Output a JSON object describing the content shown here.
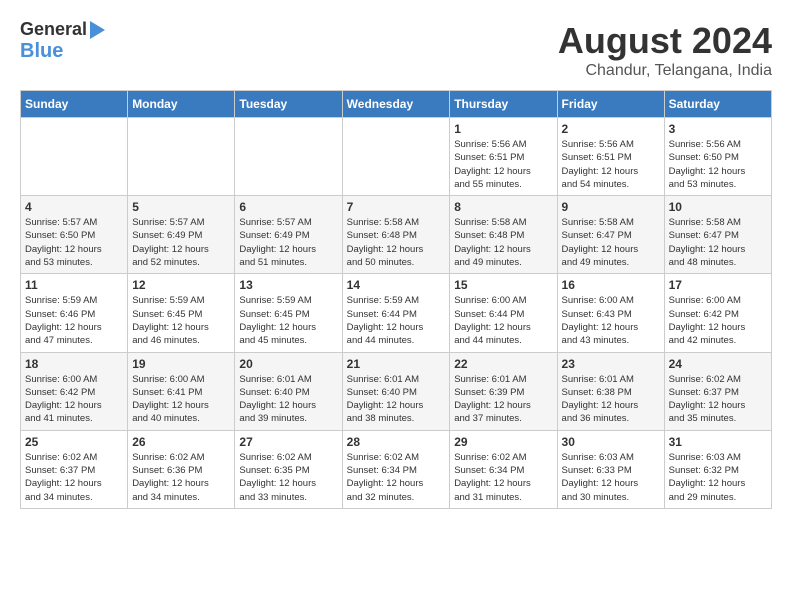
{
  "header": {
    "logo_line1": "General",
    "logo_line2": "Blue",
    "title": "August 2024",
    "subtitle": "Chandur, Telangana, India"
  },
  "calendar": {
    "days_of_week": [
      "Sunday",
      "Monday",
      "Tuesday",
      "Wednesday",
      "Thursday",
      "Friday",
      "Saturday"
    ],
    "weeks": [
      [
        {
          "day": "",
          "info": ""
        },
        {
          "day": "",
          "info": ""
        },
        {
          "day": "",
          "info": ""
        },
        {
          "day": "",
          "info": ""
        },
        {
          "day": "1",
          "info": "Sunrise: 5:56 AM\nSunset: 6:51 PM\nDaylight: 12 hours\nand 55 minutes."
        },
        {
          "day": "2",
          "info": "Sunrise: 5:56 AM\nSunset: 6:51 PM\nDaylight: 12 hours\nand 54 minutes."
        },
        {
          "day": "3",
          "info": "Sunrise: 5:56 AM\nSunset: 6:50 PM\nDaylight: 12 hours\nand 53 minutes."
        }
      ],
      [
        {
          "day": "4",
          "info": "Sunrise: 5:57 AM\nSunset: 6:50 PM\nDaylight: 12 hours\nand 53 minutes."
        },
        {
          "day": "5",
          "info": "Sunrise: 5:57 AM\nSunset: 6:49 PM\nDaylight: 12 hours\nand 52 minutes."
        },
        {
          "day": "6",
          "info": "Sunrise: 5:57 AM\nSunset: 6:49 PM\nDaylight: 12 hours\nand 51 minutes."
        },
        {
          "day": "7",
          "info": "Sunrise: 5:58 AM\nSunset: 6:48 PM\nDaylight: 12 hours\nand 50 minutes."
        },
        {
          "day": "8",
          "info": "Sunrise: 5:58 AM\nSunset: 6:48 PM\nDaylight: 12 hours\nand 49 minutes."
        },
        {
          "day": "9",
          "info": "Sunrise: 5:58 AM\nSunset: 6:47 PM\nDaylight: 12 hours\nand 49 minutes."
        },
        {
          "day": "10",
          "info": "Sunrise: 5:58 AM\nSunset: 6:47 PM\nDaylight: 12 hours\nand 48 minutes."
        }
      ],
      [
        {
          "day": "11",
          "info": "Sunrise: 5:59 AM\nSunset: 6:46 PM\nDaylight: 12 hours\nand 47 minutes."
        },
        {
          "day": "12",
          "info": "Sunrise: 5:59 AM\nSunset: 6:45 PM\nDaylight: 12 hours\nand 46 minutes."
        },
        {
          "day": "13",
          "info": "Sunrise: 5:59 AM\nSunset: 6:45 PM\nDaylight: 12 hours\nand 45 minutes."
        },
        {
          "day": "14",
          "info": "Sunrise: 5:59 AM\nSunset: 6:44 PM\nDaylight: 12 hours\nand 44 minutes."
        },
        {
          "day": "15",
          "info": "Sunrise: 6:00 AM\nSunset: 6:44 PM\nDaylight: 12 hours\nand 44 minutes."
        },
        {
          "day": "16",
          "info": "Sunrise: 6:00 AM\nSunset: 6:43 PM\nDaylight: 12 hours\nand 43 minutes."
        },
        {
          "day": "17",
          "info": "Sunrise: 6:00 AM\nSunset: 6:42 PM\nDaylight: 12 hours\nand 42 minutes."
        }
      ],
      [
        {
          "day": "18",
          "info": "Sunrise: 6:00 AM\nSunset: 6:42 PM\nDaylight: 12 hours\nand 41 minutes."
        },
        {
          "day": "19",
          "info": "Sunrise: 6:00 AM\nSunset: 6:41 PM\nDaylight: 12 hours\nand 40 minutes."
        },
        {
          "day": "20",
          "info": "Sunrise: 6:01 AM\nSunset: 6:40 PM\nDaylight: 12 hours\nand 39 minutes."
        },
        {
          "day": "21",
          "info": "Sunrise: 6:01 AM\nSunset: 6:40 PM\nDaylight: 12 hours\nand 38 minutes."
        },
        {
          "day": "22",
          "info": "Sunrise: 6:01 AM\nSunset: 6:39 PM\nDaylight: 12 hours\nand 37 minutes."
        },
        {
          "day": "23",
          "info": "Sunrise: 6:01 AM\nSunset: 6:38 PM\nDaylight: 12 hours\nand 36 minutes."
        },
        {
          "day": "24",
          "info": "Sunrise: 6:02 AM\nSunset: 6:37 PM\nDaylight: 12 hours\nand 35 minutes."
        }
      ],
      [
        {
          "day": "25",
          "info": "Sunrise: 6:02 AM\nSunset: 6:37 PM\nDaylight: 12 hours\nand 34 minutes."
        },
        {
          "day": "26",
          "info": "Sunrise: 6:02 AM\nSunset: 6:36 PM\nDaylight: 12 hours\nand 34 minutes."
        },
        {
          "day": "27",
          "info": "Sunrise: 6:02 AM\nSunset: 6:35 PM\nDaylight: 12 hours\nand 33 minutes."
        },
        {
          "day": "28",
          "info": "Sunrise: 6:02 AM\nSunset: 6:34 PM\nDaylight: 12 hours\nand 32 minutes."
        },
        {
          "day": "29",
          "info": "Sunrise: 6:02 AM\nSunset: 6:34 PM\nDaylight: 12 hours\nand 31 minutes."
        },
        {
          "day": "30",
          "info": "Sunrise: 6:03 AM\nSunset: 6:33 PM\nDaylight: 12 hours\nand 30 minutes."
        },
        {
          "day": "31",
          "info": "Sunrise: 6:03 AM\nSunset: 6:32 PM\nDaylight: 12 hours\nand 29 minutes."
        }
      ]
    ]
  }
}
